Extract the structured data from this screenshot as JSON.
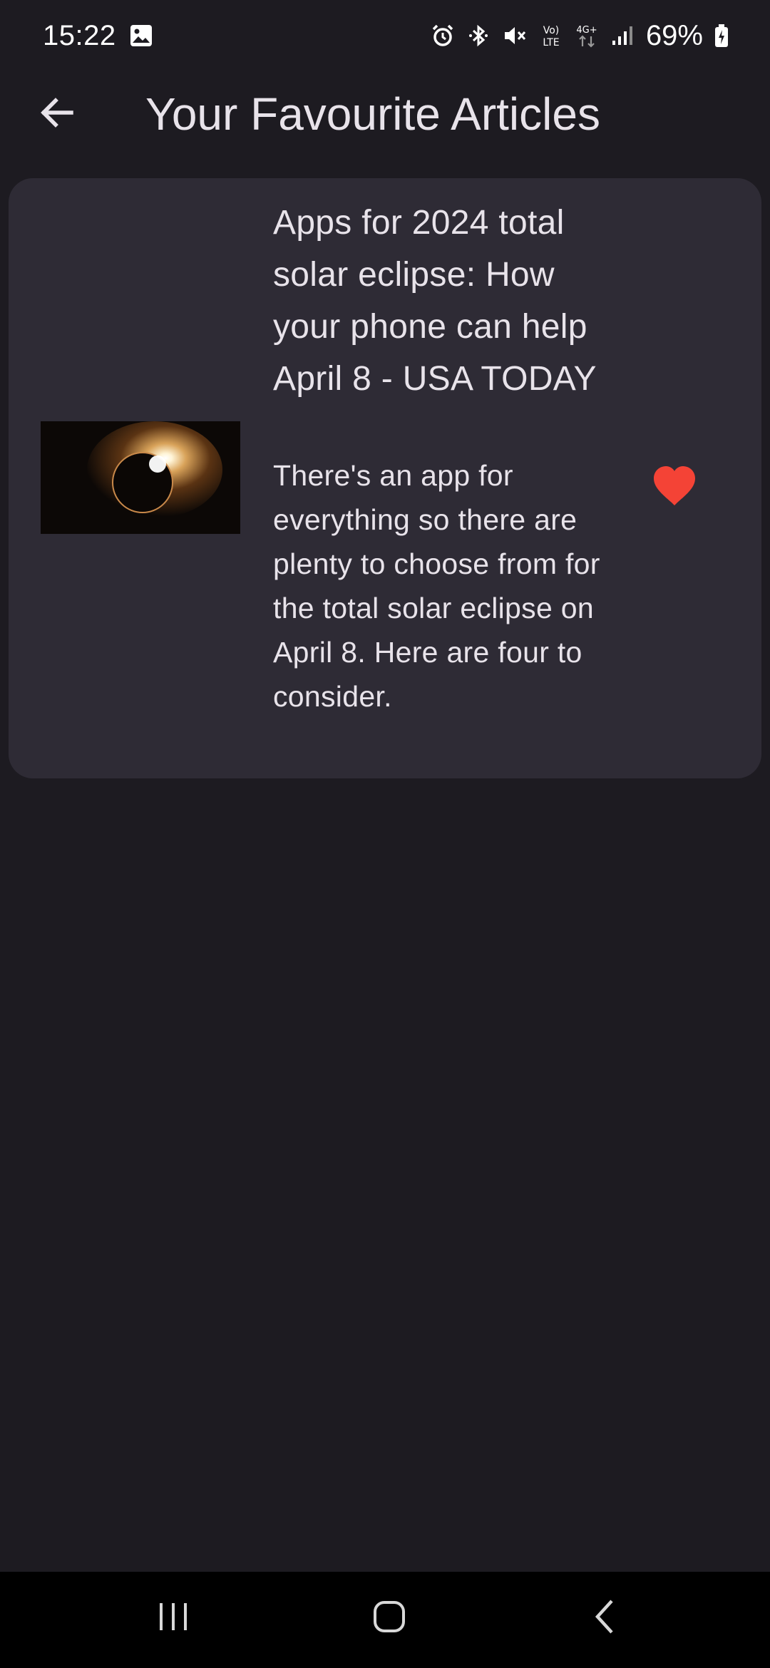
{
  "status_bar": {
    "time": "15:22",
    "battery": "69%",
    "icons": [
      "image-icon",
      "alarm-icon",
      "bluetooth-icon",
      "mute-icon",
      "volte-icon",
      "4g-icon",
      "signal-icon",
      "battery-icon"
    ],
    "volte_label_top": "Vo)",
    "volte_label_bottom": "LTE",
    "network_label": "4G+"
  },
  "app_bar": {
    "back_icon": "arrow-back-icon",
    "title": "Your Favourite Articles"
  },
  "articles": [
    {
      "title": "Apps for 2024 total solar eclipse: How your phone can help April 8 - USA TODAY",
      "description": "There's an app for everything so there are plenty to choose from for the total solar eclipse on April 8. Here are four to consider.",
      "thumbnail": "solar-eclipse-image",
      "favourite": true,
      "favourite_icon": "heart-icon"
    }
  ],
  "nav_bar": {
    "recents_icon": "recent-apps-icon",
    "home_icon": "home-icon",
    "back_icon": "back-chevron-icon"
  },
  "colors": {
    "background": "#1d1b21",
    "card": "#2e2b35",
    "heart": "#f44336",
    "text": "#e8e3ea"
  }
}
